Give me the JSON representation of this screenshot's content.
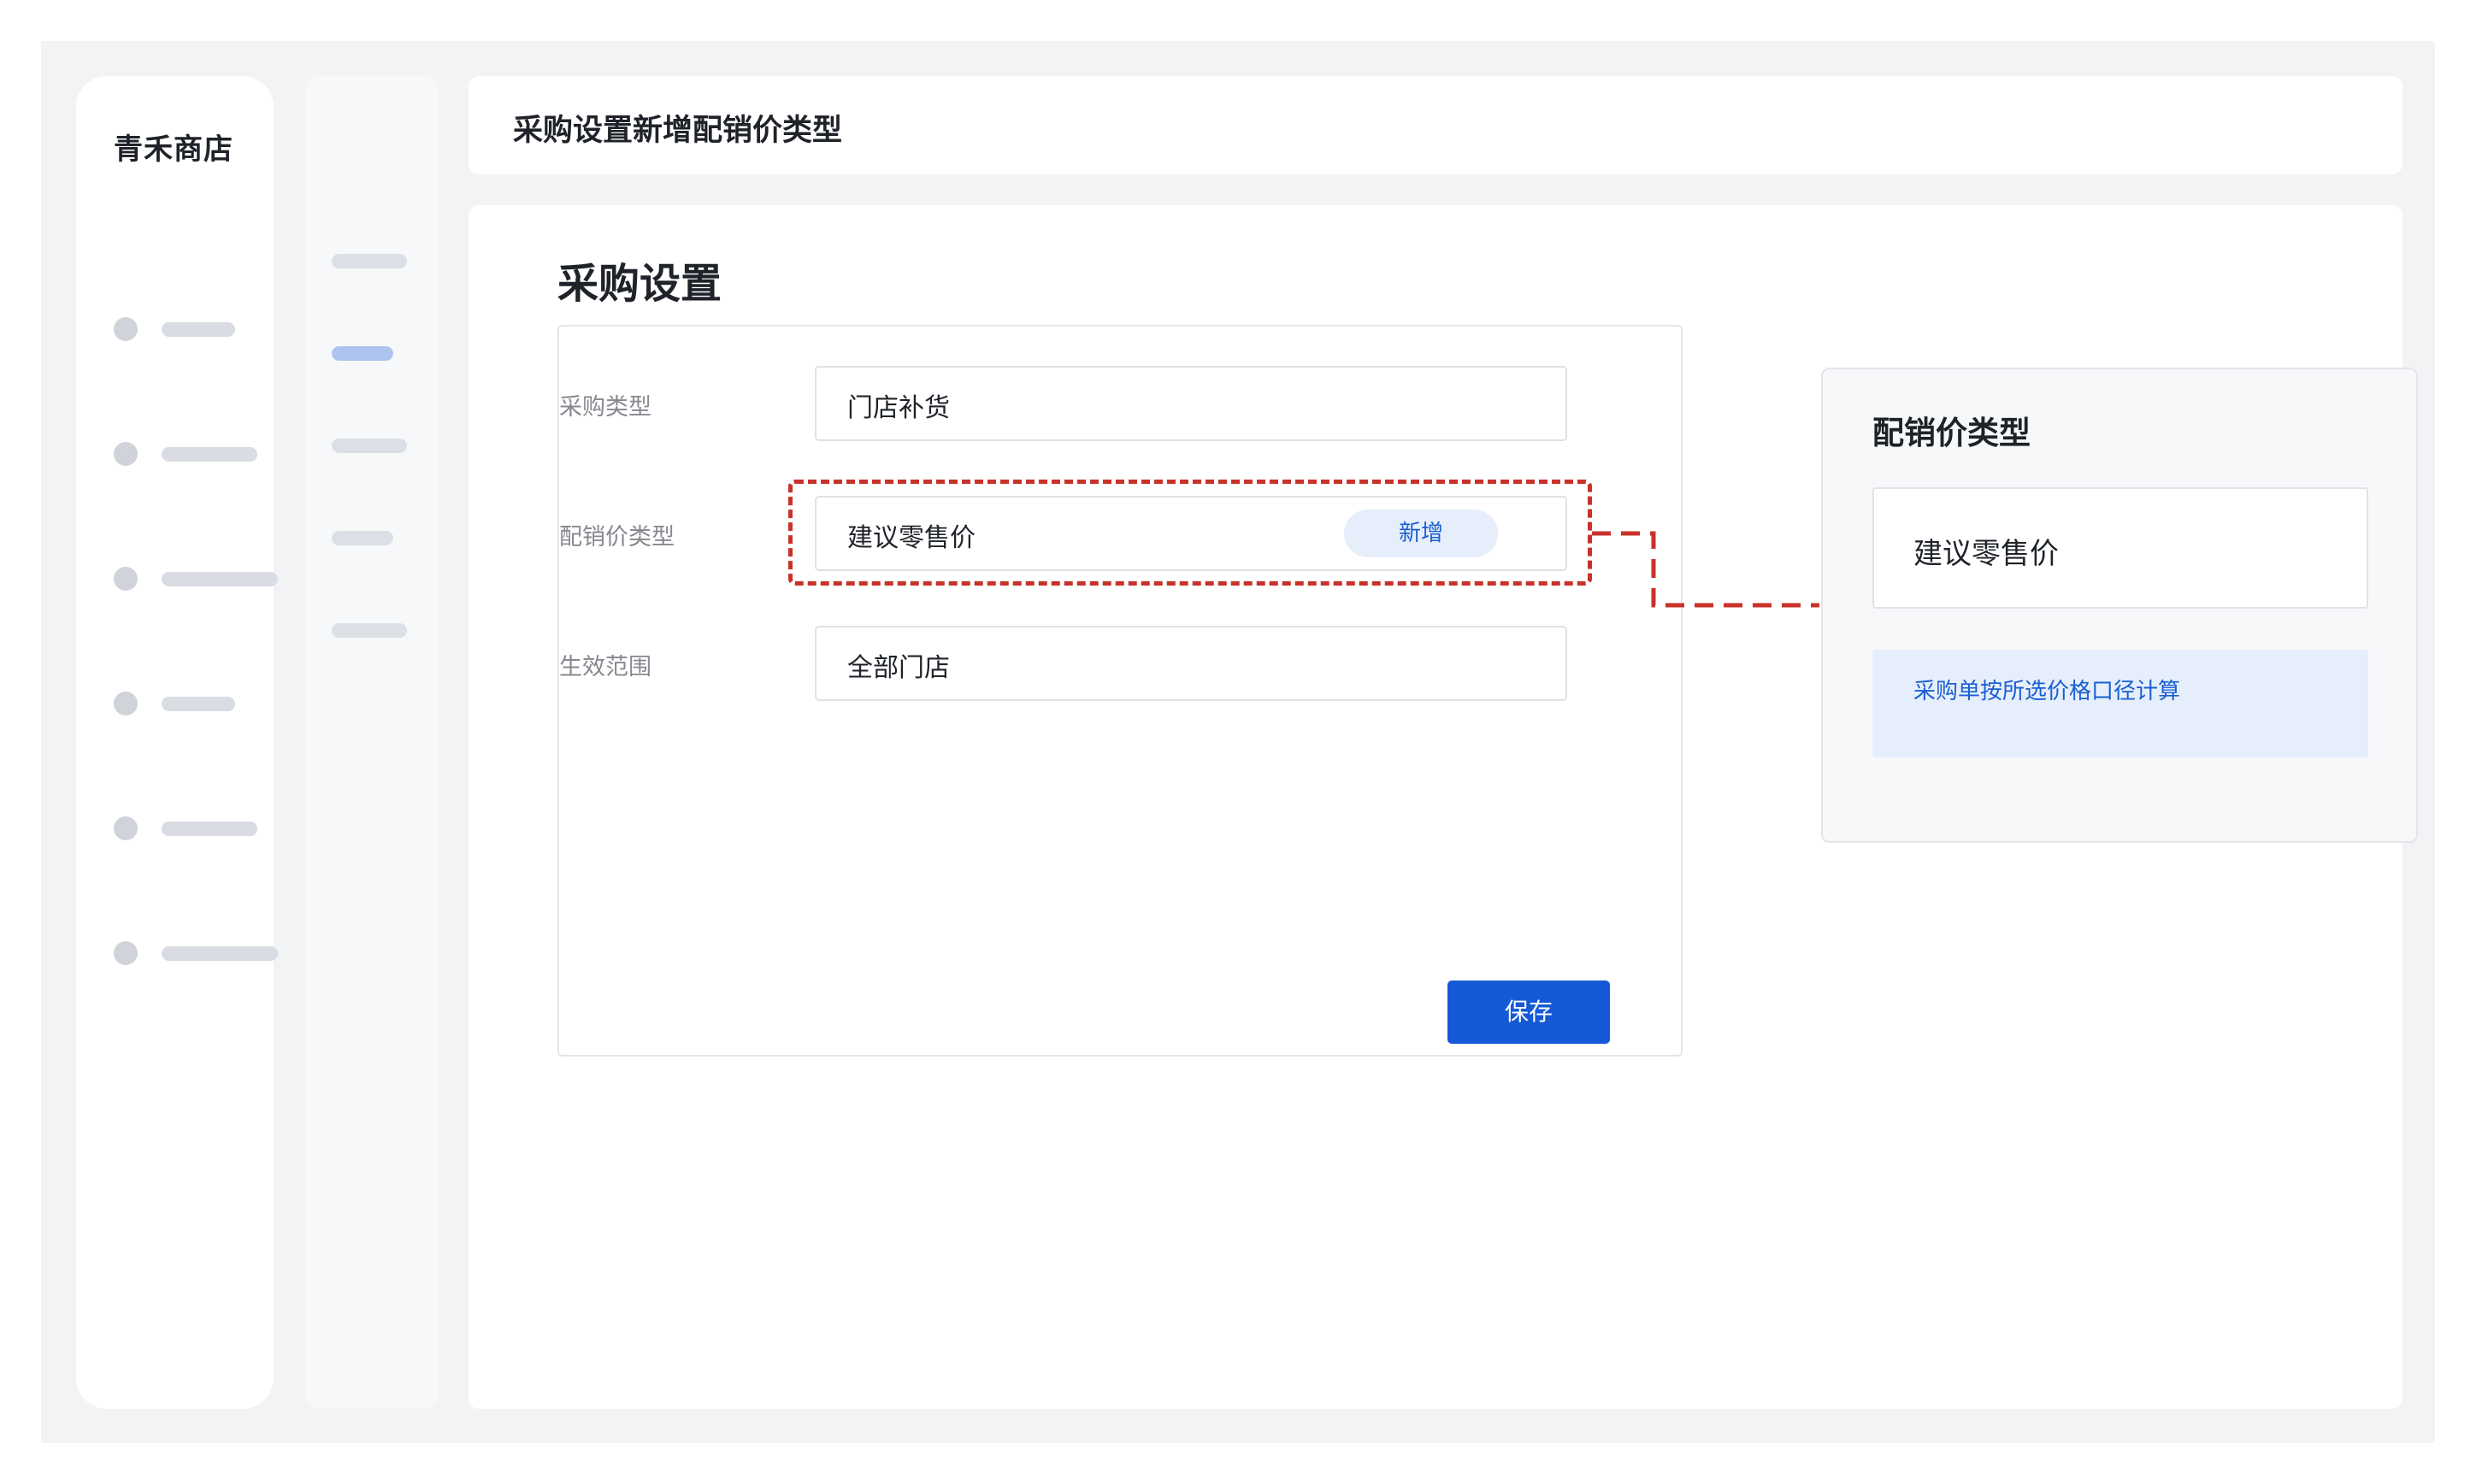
{
  "app": {
    "shop_name": "青禾商店"
  },
  "header": {
    "title": "采购设置新增配销价类型"
  },
  "page": {
    "title": "采购设置"
  },
  "form": {
    "fields": [
      {
        "label": "采购类型",
        "value": "门店补货"
      },
      {
        "label": "配销价类型",
        "value": "建议零售价",
        "action_label": "新增"
      },
      {
        "label": "生效范围",
        "value": "全部门店"
      }
    ],
    "save_label": "保存"
  },
  "side_panel": {
    "title": "配销价类型",
    "value": "建议零售价",
    "note": "采购单按所选价格口径计算"
  },
  "colors": {
    "primary": "#1559d6",
    "highlight": "#c8322a",
    "note_bg": "#e6eefc",
    "note_text": "#1a5fd0"
  }
}
